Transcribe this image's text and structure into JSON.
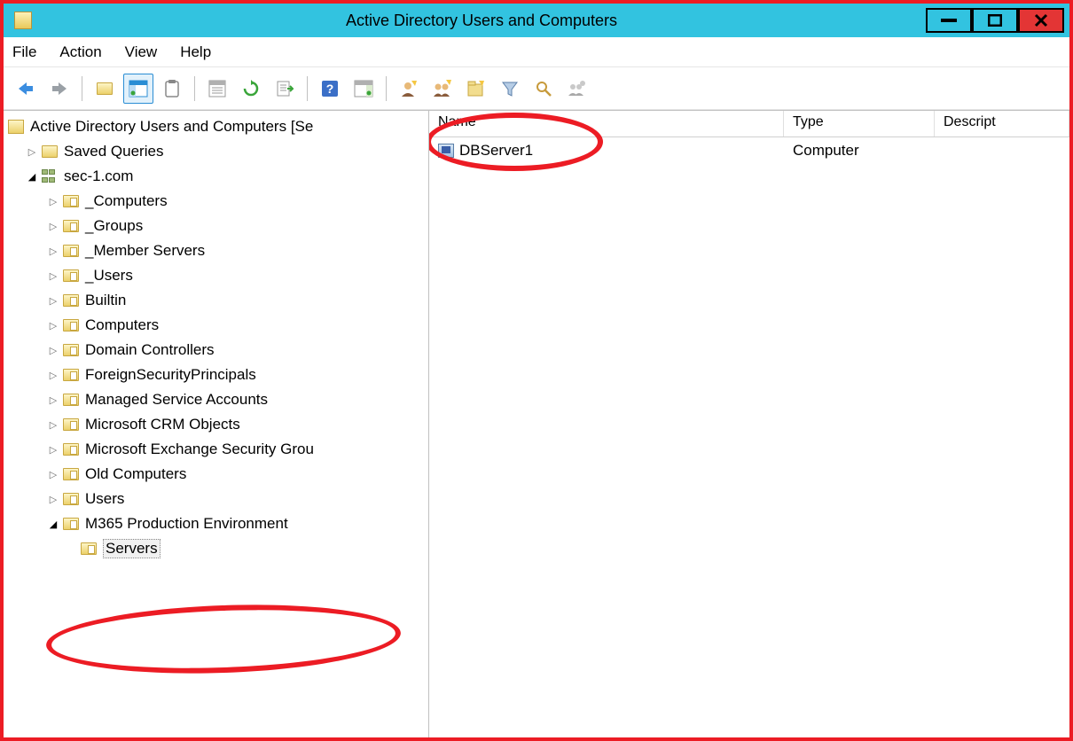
{
  "window": {
    "title": "Active Directory Users and Computers"
  },
  "menu": [
    "File",
    "Action",
    "View",
    "Help"
  ],
  "tree": {
    "root": "Active Directory Users and Computers [Se",
    "savedQueries": "Saved Queries",
    "domain": "sec-1.com",
    "ous": [
      "_Computers",
      "_Groups",
      "_Member Servers",
      "_Users",
      "Builtin",
      "Computers",
      "Domain Controllers",
      "ForeignSecurityPrincipals",
      "Managed Service Accounts",
      "Microsoft CRM Objects",
      "Microsoft Exchange Security Grou",
      "Old Computers",
      "Users",
      "M365 Production Environment"
    ],
    "subOU": "Servers"
  },
  "list": {
    "columns": {
      "name": "Name",
      "type": "Type",
      "desc": "Descript"
    },
    "rows": [
      {
        "name": "DBServer1",
        "type": "Computer",
        "desc": ""
      }
    ]
  }
}
